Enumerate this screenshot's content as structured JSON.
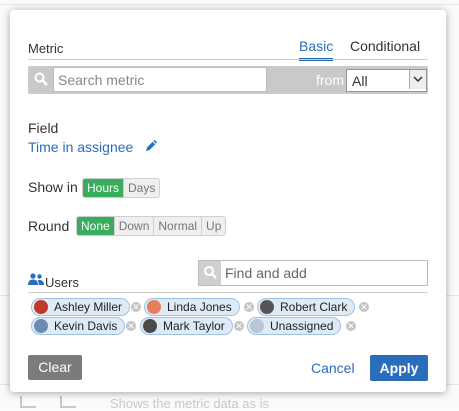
{
  "background": {
    "fragments": [
      "Shows the metric data as is"
    ]
  },
  "metric": {
    "label": "Metric",
    "tabs": [
      {
        "label": "Basic",
        "active": true
      },
      {
        "label": "Conditional",
        "active": false
      }
    ],
    "search_placeholder": "Search metric",
    "from_label": "from",
    "from_value": "All"
  },
  "field": {
    "label": "Field",
    "value": "Time in assignee"
  },
  "show_in": {
    "label": "Show in",
    "options": [
      "Hours",
      "Days"
    ],
    "selected": "Hours"
  },
  "round": {
    "label": "Round",
    "options": [
      "None",
      "Down",
      "Normal",
      "Up"
    ],
    "selected": "None"
  },
  "users": {
    "label": "Users",
    "find_placeholder": "Find and add",
    "chips": [
      {
        "name": "Ashley Miller",
        "avatar_color": "#c0392b"
      },
      {
        "name": "Linda Jones",
        "avatar_color": "#e67e5b"
      },
      {
        "name": "Robert Clark",
        "avatar_color": "#555555"
      },
      {
        "name": "Kevin Davis",
        "avatar_color": "#6b8cae"
      },
      {
        "name": "Mark Taylor",
        "avatar_color": "#4a4a4a"
      },
      {
        "name": "Unassigned",
        "avatar_color": "#b7c7d8"
      }
    ]
  },
  "actions": {
    "clear": "Clear",
    "cancel": "Cancel",
    "apply": "Apply"
  },
  "colors": {
    "accent": "#2a6ebb",
    "toggle_on": "#3aac5d",
    "chip_bg": "#deebf7"
  }
}
